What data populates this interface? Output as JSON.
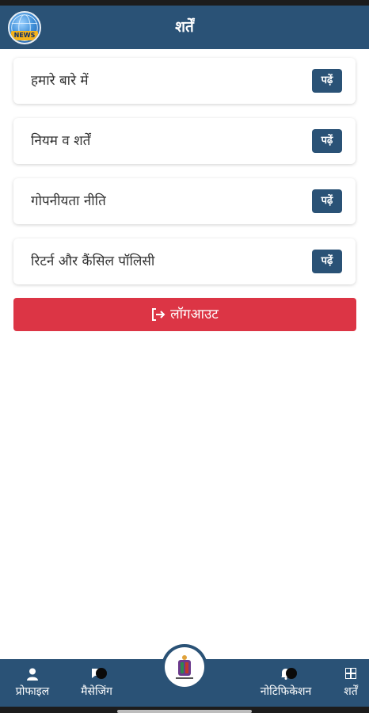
{
  "header": {
    "title": "शर्तें",
    "logo_text": "NEWS"
  },
  "items": [
    {
      "label": "हमारे बारे में",
      "button": "पढ़ें"
    },
    {
      "label": "नियम व शर्तें",
      "button": "पढ़ें"
    },
    {
      "label": "गोपनीयता नीति",
      "button": "पढ़ें"
    },
    {
      "label": "रिटर्न और कैंसिल पॉलिसी",
      "button": "पढ़ें"
    }
  ],
  "logout": {
    "label": "लॉगआउट",
    "icon": "logout-icon",
    "color": "#dc3545"
  },
  "bottom_nav": {
    "items": [
      {
        "label": "प्रोफाइल",
        "icon": "user-icon"
      },
      {
        "label": "मैसेजिंग",
        "icon": "message-icon"
      },
      {
        "label": "नोटिफिकेशन",
        "icon": "bell-icon"
      },
      {
        "label": "शर्तें",
        "icon": "grid-icon"
      }
    ],
    "center_icon": "brand-emblem-icon"
  },
  "colors": {
    "primary": "#2a5276",
    "danger": "#dc3545",
    "background": "#ffffff"
  }
}
